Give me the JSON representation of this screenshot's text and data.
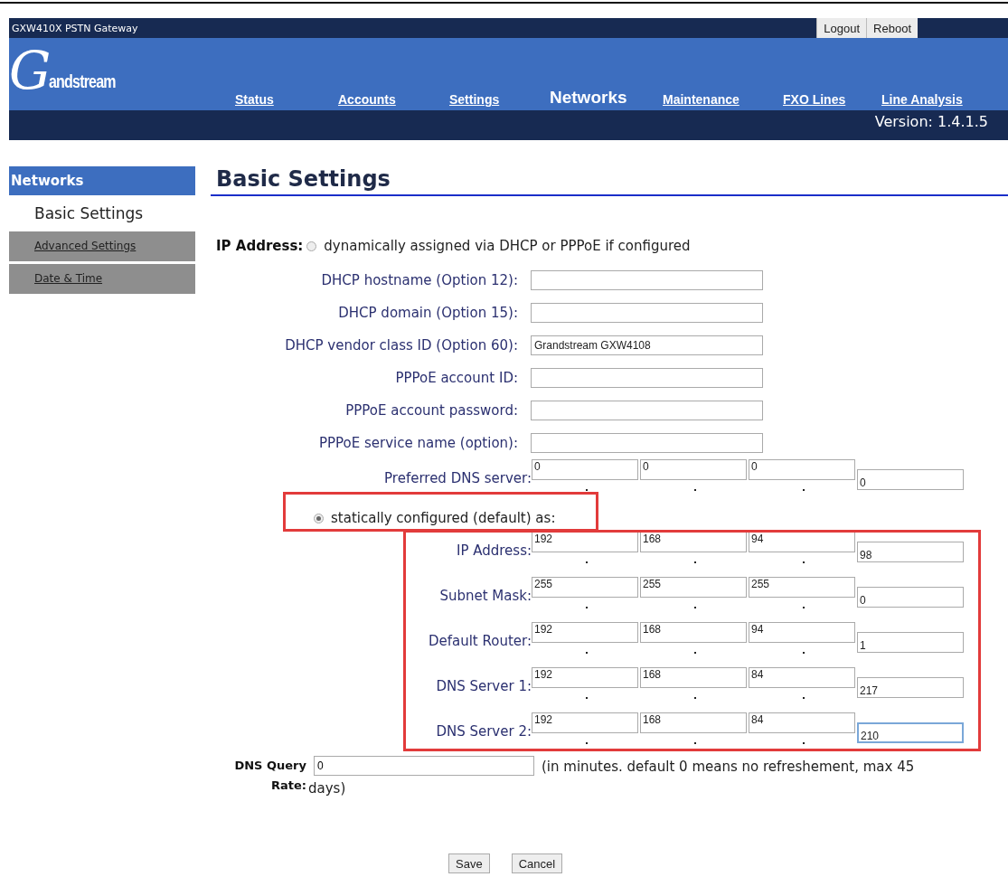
{
  "header": {
    "product": "GXW410X PSTN Gateway",
    "buttons": [
      "Logout",
      "Reboot"
    ],
    "logo": {
      "initial": "G",
      "rest": "andstream"
    },
    "nav": [
      {
        "label": "Status",
        "selected": false
      },
      {
        "label": "Accounts",
        "selected": false
      },
      {
        "label": "Settings",
        "selected": false
      },
      {
        "label": "Networks",
        "selected": true
      },
      {
        "label": "Maintenance",
        "selected": false
      },
      {
        "label": "FXO Lines",
        "selected": false
      },
      {
        "label": "Line Analysis",
        "selected": false
      }
    ],
    "version": "Version: 1.4.1.5"
  },
  "sidebar": {
    "title": "Networks",
    "items": [
      {
        "label": "Basic Settings",
        "selected": true
      },
      {
        "label": "Advanced Settings",
        "selected": false
      },
      {
        "label": "Date & Time",
        "selected": false
      }
    ]
  },
  "page_title": "Basic Settings",
  "ip_mode": {
    "label": "IP Address:",
    "options": [
      {
        "label": "dynamically assigned via DHCP or PPPoE if configured",
        "selected": false,
        "highlighted": false
      },
      {
        "label": "statically configured (default) as:",
        "selected": true,
        "highlighted": true
      }
    ]
  },
  "dhcp_fields": [
    {
      "label": "DHCP hostname (Option 12):"
    },
    {
      "label": "DHCP domain (Option 15):"
    },
    {
      "label": "DHCP vendor class ID (Option 60):",
      "value": "Grandstream GXW4108"
    },
    {
      "label": "PPPoE account ID:"
    },
    {
      "label": "PPPoE account password:"
    },
    {
      "label": "PPPoE service name (option):"
    }
  ],
  "preferred_dns": {
    "label": "Preferred DNS server:",
    "octets": [
      "0",
      "0",
      "0",
      "0"
    ],
    "focused": false
  },
  "static_group": {
    "highlighted": true,
    "fields": [
      {
        "label": "IP Address:",
        "octets": [
          "192",
          "168",
          "94",
          "98"
        ],
        "focused": false
      },
      {
        "label": "Subnet Mask:",
        "octets": [
          "255",
          "255",
          "255",
          "0"
        ],
        "focused": false
      },
      {
        "label": "Default Router:",
        "octets": [
          "192",
          "168",
          "94",
          "1"
        ],
        "focused": false
      },
      {
        "label": "DNS Server 1:",
        "octets": [
          "192",
          "168",
          "84",
          "217"
        ],
        "focused": false
      },
      {
        "label": "DNS Server 2:",
        "octets": [
          "192",
          "168",
          "84",
          "210"
        ],
        "focused": true
      }
    ]
  },
  "dns_query": {
    "label": "DNS Query Rate:",
    "value": "0",
    "note_lines": [
      "(in minutes. default 0 means no refreshement, max 45",
      "days)"
    ]
  },
  "buttons": [
    "Save",
    "Cancel"
  ]
}
